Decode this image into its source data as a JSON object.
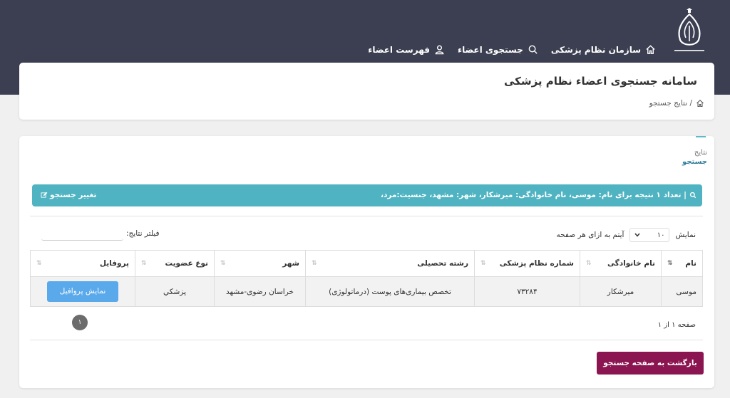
{
  "nav": {
    "items": [
      {
        "label": "سازمان نظام پزشکی",
        "icon": "home-icon"
      },
      {
        "label": "جستجوی اعضاء",
        "icon": "search-icon"
      },
      {
        "label": "فهرست اعضاء",
        "icon": "user-icon"
      }
    ]
  },
  "header": {
    "title": "سامانه جستجوی اعضاء نظام پزشکی",
    "breadcrumb": "/ نتایج جستجو"
  },
  "results": {
    "section_label_line1": "نتایج",
    "section_label_line2": "جستجو",
    "info_text": "| تعداد ۱ نتیجه برای نام: موسی، نام خانوادگی: میرشکار، شهر: مشهد، جنسیت:مرد،",
    "change_search": "تغییر جستجو",
    "show_label": "نمایش",
    "page_size": "۱۰",
    "per_page_label": "آیتم به ازای هر صفحه",
    "filter_label": "فیلتر نتایج:",
    "filter_value": "",
    "columns": [
      "نام",
      "نام خانوادگی",
      "شماره نظام پزشکی",
      "رشته تحصیلی",
      "شهر",
      "نوع عضویت",
      "پروفایل"
    ],
    "rows": [
      {
        "first_name": "موسی",
        "last_name": "میرشکار",
        "medical_no": "۷۳۲۸۴",
        "field": "تخصص بیماری‌های پوست (درماتولوژی)",
        "city": "خراسان رضوی-مشهد",
        "membership": "پزشکي",
        "profile_button": "نمایش پروافیل"
      }
    ],
    "page_button": "۱",
    "page_info": "صفحه ۱ از ۱",
    "back_button": "بازگشت به صفحه جستجو"
  },
  "colors": {
    "header_bg": "#3b3f51",
    "info_bar": "#4fb3c2",
    "profile_btn": "#5aa9ea",
    "back_btn": "#8a1550"
  }
}
